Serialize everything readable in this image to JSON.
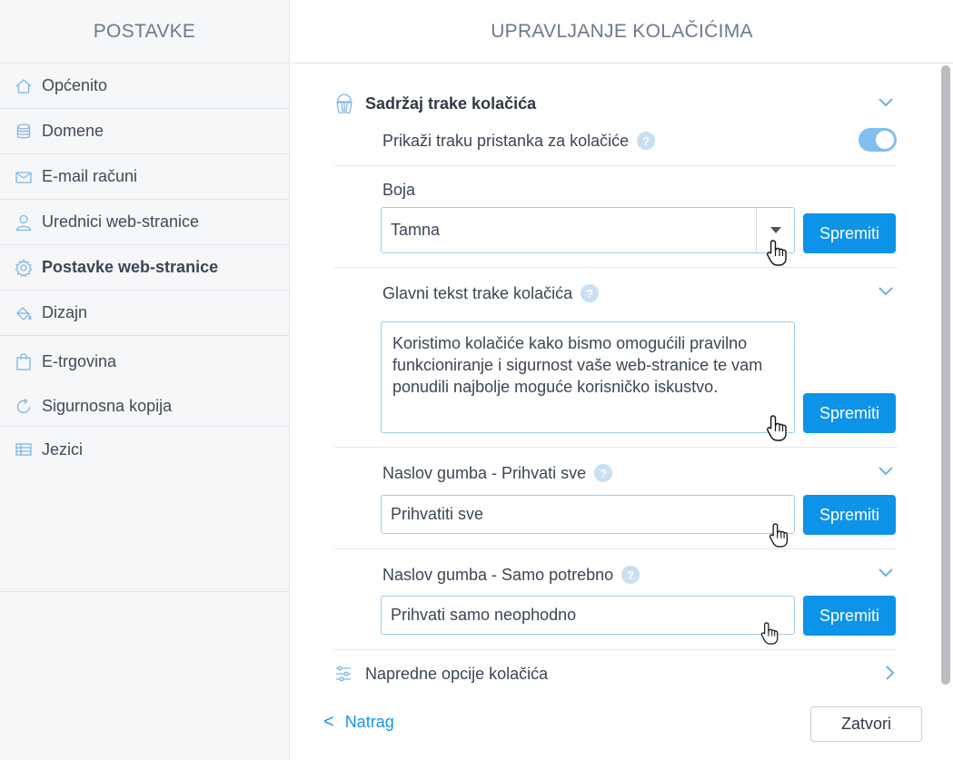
{
  "sidebar": {
    "title": "POSTAVKE",
    "items": [
      {
        "label": "Općenito",
        "icon": "home-icon"
      },
      {
        "label": "Domene",
        "icon": "database-icon"
      },
      {
        "label": "E-mail računi",
        "icon": "envelope-icon"
      },
      {
        "label": "Urednici web-stranice",
        "icon": "user-icon"
      },
      {
        "label": "Postavke web-stranice",
        "icon": "gear-icon",
        "active": true
      },
      {
        "label": "Dizajn",
        "icon": "paint-bucket-icon"
      },
      {
        "label": "E-trgovina",
        "icon": "shopping-bag-icon"
      },
      {
        "label": "Sigurnosna kopija",
        "icon": "refresh-icon"
      },
      {
        "label": "Jezici",
        "icon": "table-icon"
      }
    ]
  },
  "main": {
    "title": "UPRAVLJANJE KOLAČIĆIMA",
    "section_title": "Sadržaj trake kolačića",
    "toggle": {
      "label": "Prikaži traku pristanka za kolačiće",
      "on": true
    },
    "color": {
      "label": "Boja",
      "value": "Tamna",
      "save": "Spremiti"
    },
    "main_text": {
      "label": "Glavni tekst trake kolačića",
      "value": "Koristimo kolačiće kako bismo omogućili pravilno funkcioniranje i sigurnost vaše web-stranice te vam ponudili najbolje moguće korisničko iskustvo.",
      "save": "Spremiti"
    },
    "accept_all": {
      "label": "Naslov gumba - Prihvati sve",
      "value": "Prihvatiti sve",
      "save": "Spremiti"
    },
    "necessary_only": {
      "label": "Naslov gumba - Samo potrebno",
      "value": "Prihvati samo neophodno",
      "save": "Spremiti"
    },
    "advanced": "Napredne opcije kolačića",
    "help_glyph": "?"
  },
  "footer": {
    "back": "Natrag",
    "back_glyph": "<",
    "close": "Zatvori"
  },
  "colors": {
    "accent": "#0d93e8",
    "toggle_on": "#7fbfef",
    "sidebar_bg": "#f6f7f8",
    "link": "#1793e6"
  }
}
